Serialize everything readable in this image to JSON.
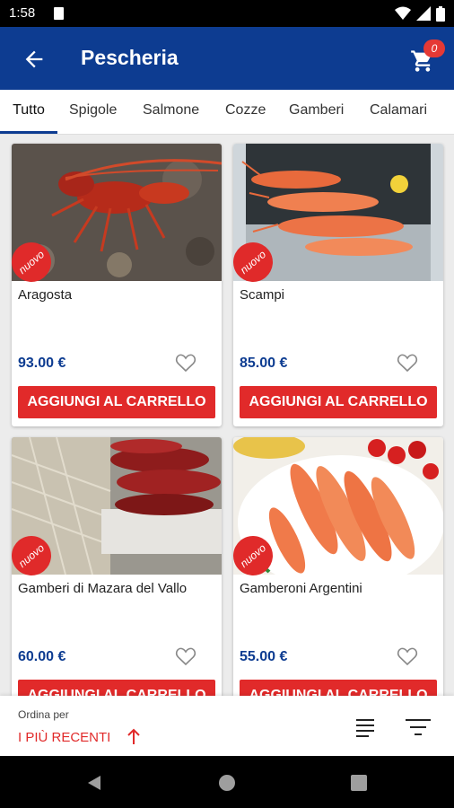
{
  "status_bar": {
    "time": "1:58"
  },
  "app_bar": {
    "title": "Pescheria",
    "cart_count": "0"
  },
  "tabs": [
    {
      "label": "Tutto",
      "active": true
    },
    {
      "label": "Spigole"
    },
    {
      "label": "Salmone"
    },
    {
      "label": "Cozze"
    },
    {
      "label": "Gamberi"
    },
    {
      "label": "Calamari"
    }
  ],
  "products": [
    {
      "name": "Aragosta",
      "price": "93.00 €",
      "badge": "nuovo",
      "add_label": "AGGIUNGI AL CARRELLO",
      "image": "lobster-photo"
    },
    {
      "name": "Scampi",
      "price": "85.00 €",
      "badge": "nuovo",
      "add_label": "AGGIUNGI AL CARRELLO",
      "image": "scampi-photo"
    },
    {
      "name": "Gamberi di Mazara del Vallo",
      "price": "60.00 €",
      "badge": "nuovo",
      "add_label": "AGGIUNGI AL CARRELLO",
      "image": "red-prawns-photo"
    },
    {
      "name": "Gamberoni Argentini",
      "price": "55.00 €",
      "badge": "nuovo",
      "add_label": "AGGIUNGI AL CARRELLO",
      "image": "argentine-prawns-photo"
    }
  ],
  "sort": {
    "label": "Ordina per",
    "value": "I PIÙ RECENTI"
  },
  "colors": {
    "primary": "#0d3c91",
    "accent": "#e12a2a"
  }
}
